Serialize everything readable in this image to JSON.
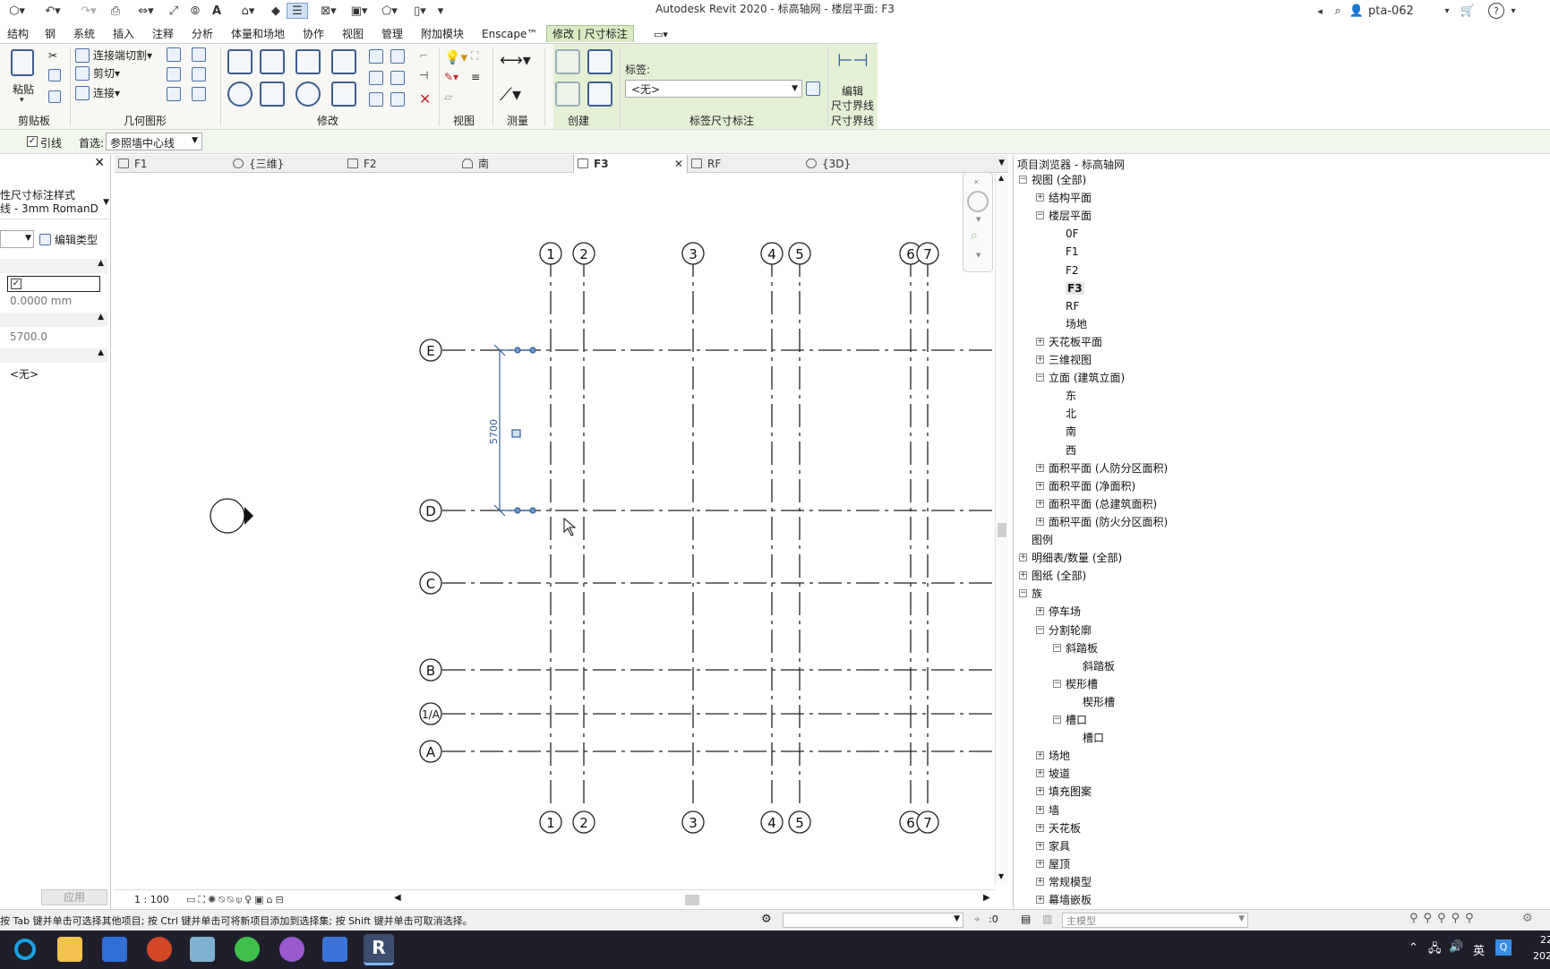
{
  "title_bar": {
    "app_title": "Autodesk Revit 2020 - 标高轴网 - 楼层平面: F3",
    "user": "pta-062",
    "help": "?"
  },
  "ribbon_tabs": [
    "结构",
    "钢",
    "系统",
    "插入",
    "注释",
    "分析",
    "体量和场地",
    "协作",
    "视图",
    "管理",
    "附加模块",
    "Enscape™"
  ],
  "context_tab": "修改 | 尺寸标注",
  "ribbon": {
    "clipboard": {
      "paste": "粘贴",
      "label": "剪贴板"
    },
    "geometry": {
      "cut_join": "连接端切割",
      "cut": "剪切",
      "join": "连接",
      "label": "几何图形"
    },
    "modify_label": "修改",
    "view_label": "视图",
    "measure_label": "测量",
    "create_label": "创建",
    "label_dim": {
      "tag_caption": "标签:",
      "tag_value": "<无>",
      "label": "标签尺寸标注"
    },
    "witness": {
      "edit1": "编辑",
      "edit2": "尺寸界线",
      "label": "尺寸界线"
    }
  },
  "options_bar": {
    "leader_label": "引线",
    "leader_checked": true,
    "prefer_label": "首选:",
    "prefer_value": "参照墙中心线"
  },
  "properties": {
    "type_line1": "性尺寸标注样式",
    "type_line2": "线 - 3mm RomanD",
    "edit_type": "编辑类型",
    "value_zero": "0.0000 mm",
    "value_dim": "5700.0",
    "value_none": "<无>",
    "apply": "应用"
  },
  "view_tabs": [
    {
      "label": "F1",
      "active": false
    },
    {
      "label": "{三维}",
      "active": false
    },
    {
      "label": "F2",
      "active": false
    },
    {
      "label": "南",
      "active": false
    },
    {
      "label": "F3",
      "active": true
    },
    {
      "label": "RF",
      "active": false
    },
    {
      "label": "{3D}",
      "active": false
    }
  ],
  "drawing": {
    "vertical_grids": [
      "1",
      "2",
      "3",
      "4",
      "5",
      "6",
      "7"
    ],
    "horizontal_grids": [
      "E",
      "D",
      "C",
      "B",
      "1/A",
      "A"
    ],
    "dimension_value": "5700",
    "scale": "1 : 100"
  },
  "project_browser": {
    "title": "项目浏览器 - 标高轴网",
    "items": [
      {
        "label": "视图 (全部)",
        "level": 0,
        "exp": "-"
      },
      {
        "label": "结构平面",
        "level": 1,
        "exp": "+"
      },
      {
        "label": "楼层平面",
        "level": 1,
        "exp": "-"
      },
      {
        "label": "0F",
        "level": 2,
        "exp": ""
      },
      {
        "label": "F1",
        "level": 2,
        "exp": ""
      },
      {
        "label": "F2",
        "level": 2,
        "exp": ""
      },
      {
        "label": "F3",
        "level": 2,
        "exp": "",
        "selected": true
      },
      {
        "label": "RF",
        "level": 2,
        "exp": ""
      },
      {
        "label": "场地",
        "level": 2,
        "exp": ""
      },
      {
        "label": "天花板平面",
        "level": 1,
        "exp": "+"
      },
      {
        "label": "三维视图",
        "level": 1,
        "exp": "+"
      },
      {
        "label": "立面 (建筑立面)",
        "level": 1,
        "exp": "-"
      },
      {
        "label": "东",
        "level": 2,
        "exp": ""
      },
      {
        "label": "北",
        "level": 2,
        "exp": ""
      },
      {
        "label": "南",
        "level": 2,
        "exp": ""
      },
      {
        "label": "西",
        "level": 2,
        "exp": ""
      },
      {
        "label": "面积平面 (人防分区面积)",
        "level": 1,
        "exp": "+"
      },
      {
        "label": "面积平面 (净面积)",
        "level": 1,
        "exp": "+"
      },
      {
        "label": "面积平面 (总建筑面积)",
        "level": 1,
        "exp": "+"
      },
      {
        "label": "面积平面 (防火分区面积)",
        "level": 1,
        "exp": "+"
      },
      {
        "label": "图例",
        "level": 0,
        "exp": ""
      },
      {
        "label": "明细表/数量 (全部)",
        "level": 0,
        "exp": "+"
      },
      {
        "label": "图纸 (全部)",
        "level": 0,
        "exp": "+"
      },
      {
        "label": "族",
        "level": 0,
        "exp": "-"
      },
      {
        "label": "停车场",
        "level": 1,
        "exp": "+"
      },
      {
        "label": "分割轮廓",
        "level": 1,
        "exp": "-"
      },
      {
        "label": "斜踏板",
        "level": 2,
        "exp": "-"
      },
      {
        "label": "斜踏板",
        "level": 3,
        "exp": ""
      },
      {
        "label": "楔形槽",
        "level": 2,
        "exp": "-"
      },
      {
        "label": "楔形槽",
        "level": 3,
        "exp": ""
      },
      {
        "label": "槽口",
        "level": 2,
        "exp": "-"
      },
      {
        "label": "槽口",
        "level": 3,
        "exp": ""
      },
      {
        "label": "场地",
        "level": 1,
        "exp": "+"
      },
      {
        "label": "坡道",
        "level": 1,
        "exp": "+"
      },
      {
        "label": "填充图案",
        "level": 1,
        "exp": "+"
      },
      {
        "label": "墙",
        "level": 1,
        "exp": "+"
      },
      {
        "label": "天花板",
        "level": 1,
        "exp": "+"
      },
      {
        "label": "家具",
        "level": 1,
        "exp": "+"
      },
      {
        "label": "屋顶",
        "level": 1,
        "exp": "+"
      },
      {
        "label": "常规模型",
        "level": 1,
        "exp": "+"
      },
      {
        "label": "幕墙嵌板",
        "level": 1,
        "exp": "+"
      }
    ]
  },
  "status_bar": {
    "message": "按 Tab 键并单击可选择其他项目; 按 Ctrl 键并单击可将新项目添加到选择集; 按 Shift 键并单击可取消选择。",
    "filter_count": ":0",
    "model": "主模型"
  },
  "taskbar": {
    "ime": "英",
    "time": "22",
    "date": "202"
  },
  "colors": {
    "ribbon_context": "#e4f1d5",
    "selection": "#2f5f9e",
    "taskbar": "#1f1f2b"
  }
}
